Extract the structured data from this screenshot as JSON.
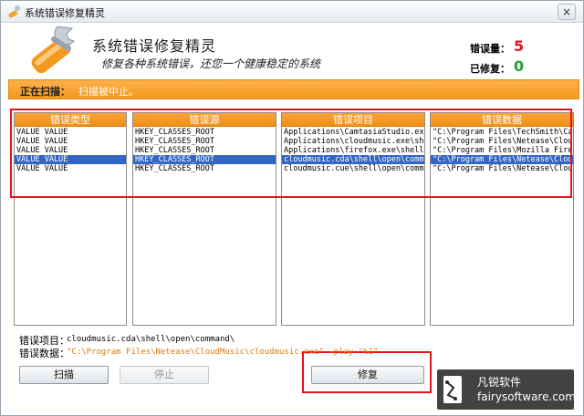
{
  "window": {
    "title": "系统错误修复精灵",
    "close_label": "×"
  },
  "header": {
    "title": "系统错误修复精灵",
    "subtitle": "修复各种系统错误，还您一个健康稳定的系统",
    "errors_label": "错误量：",
    "errors_value": "5",
    "fixed_label": "已修复：",
    "fixed_value": "0"
  },
  "scan": {
    "label": "正在扫描：",
    "status": "扫描被中止。"
  },
  "columns": [
    {
      "header": "错误类型",
      "rows": [
        "VALUE VALUE",
        "VALUE VALUE",
        "VALUE VALUE",
        "VALUE VALUE",
        "VALUE VALUE"
      ]
    },
    {
      "header": "错误源",
      "rows": [
        "HKEY_CLASSES_ROOT",
        "HKEY_CLASSES_ROOT",
        "HKEY_CLASSES_ROOT",
        "HKEY_CLASSES_ROOT",
        "HKEY_CLASSES_ROOT"
      ]
    },
    {
      "header": "错误项目",
      "rows": [
        "Applications\\CamtasiaStudio.exe\\",
        "Applications\\cloudmusic.exe\\shel",
        "Applications\\firefox.exe\\shell\\",
        "cloudmusic.cda\\shell\\open\\command",
        "cloudmusic.cue\\shell\\open\\command"
      ]
    },
    {
      "header": "错误数据",
      "rows": [
        "\"C:\\Program Files\\TechSmith\\Cam",
        "\"C:\\Program Files\\Netease\\Cloud",
        "\"C:\\Program Files\\Mozilla Firef",
        "\"C:\\Program Files\\Netease\\Cloud",
        "\"C:\\Program Files\\Netease\\Cloud"
      ]
    }
  ],
  "selected_row_index": 3,
  "details": {
    "item_label": "错误项目：",
    "item_value": "cloudmusic.cda\\shell\\open\\command\\",
    "data_label": "错误数据：",
    "data_value": "\"C:\\Program Files\\Netease\\CloudMusic\\cloudmusic.exe\" -play \"%1\""
  },
  "buttons": {
    "scan": "扫描",
    "stop": "停止",
    "repair": "修复"
  },
  "watermark": {
    "cn": "凡锐软件",
    "en": "fairysoftware.com"
  },
  "colors": {
    "accent_orange": "#f39a1e",
    "errors_red": "#e3141b",
    "fixed_green": "#21a23a",
    "selection_blue": "#3166c7",
    "data_value_orange": "#e07a10"
  }
}
